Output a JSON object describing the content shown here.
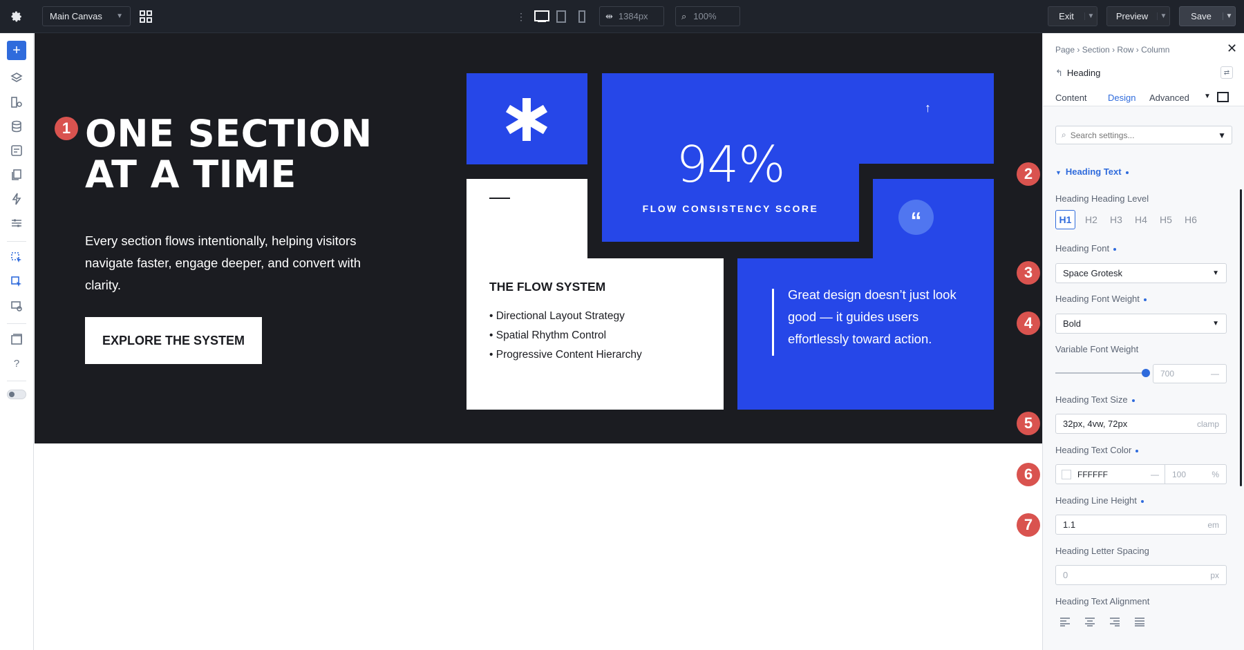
{
  "topbar": {
    "canvas_select": "Main Canvas",
    "width_value": "1384px",
    "zoom_value": "100%",
    "exit_label": "Exit",
    "preview_label": "Preview",
    "save_label": "Save"
  },
  "hero": {
    "heading": "ONE SECTION AT A TIME",
    "paragraph": "Every section flows intentionally, helping visitors navigate faster, engage deeper, and convert with clarity.",
    "button_label": "EXPLORE THE SYSTEM"
  },
  "grid": {
    "stat_value": "94%",
    "stat_label": "FLOW CONSISTENCY SCORE",
    "card_title": "THE FLOW SYSTEM",
    "list_items": [
      "Directional Layout Strategy",
      "Spatial Rhythm Control",
      "Progressive Content Hierarchy"
    ],
    "quote_text": "Great design doesn’t just look good — it guides users effortlessly toward action."
  },
  "panel": {
    "breadcrumb": [
      "Page",
      "Section",
      "Row",
      "Column"
    ],
    "element_title": "Heading",
    "tabs": [
      "Content",
      "Design",
      "Advanced"
    ],
    "active_tab": "Design",
    "search_placeholder": "Search settings...",
    "group_title": "Heading Text",
    "level_label": "Heading Heading Level",
    "levels": [
      "H1",
      "H2",
      "H3",
      "H4",
      "H5",
      "H6"
    ],
    "font_label": "Heading Font",
    "font_value": "Space Grotesk",
    "weight_label": "Heading Font Weight",
    "weight_value": "Bold",
    "variable_label": "Variable Font Weight",
    "variable_value": "700",
    "size_label": "Heading Text Size",
    "size_value": "32px, 4vw, 72px",
    "size_unit": "clamp",
    "color_label": "Heading Text Color",
    "color_value": "FFFFFF",
    "opacity_value": "100",
    "opacity_unit": "%",
    "lineheight_label": "Heading Line Height",
    "lineheight_value": "1.1",
    "lineheight_unit": "em",
    "spacing_label": "Heading Letter Spacing",
    "spacing_value": "0",
    "spacing_unit": "px",
    "align_label": "Heading Text Alignment"
  },
  "badges": [
    "1",
    "2",
    "3",
    "4",
    "5",
    "6",
    "7"
  ],
  "colors": {
    "accent_blue": "#2647e8",
    "dark_bg": "#1b1c21",
    "badge_red": "#d9534f",
    "panel_accent": "#2f6bdc"
  }
}
